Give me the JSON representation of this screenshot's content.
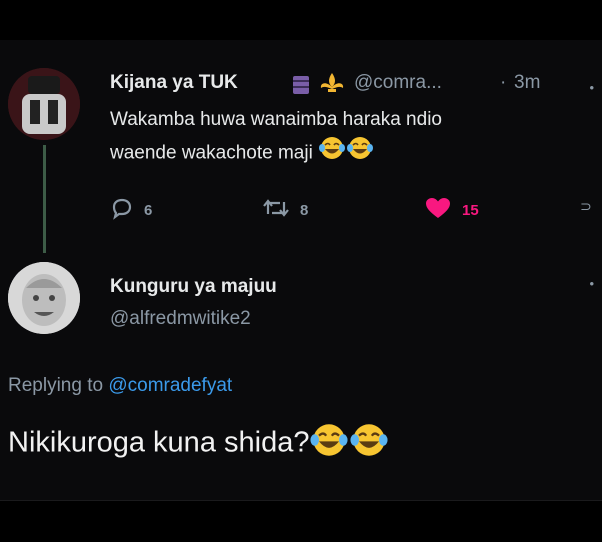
{
  "tweet": {
    "author_name": "Kijana ya TUK",
    "badge_icons": [
      "book-emoji-icon",
      "fleur-de-lis-icon"
    ],
    "handle": "@comra...",
    "separator": "·",
    "time": "3m",
    "text_line1": "Wakamba huwa wanaimba haraka ndio",
    "text_line2": "waende wakachote maji",
    "emoji": "joy-emoji-icon",
    "reply_count": "6",
    "retweet_count": "8",
    "like_count": "15",
    "like_color": "#f91880"
  },
  "reply": {
    "author_name": "Kunguru ya majuu",
    "handle": "@alfredmwitike2",
    "replying_prefix": "Replying to",
    "replying_to": "@comradefyat",
    "text": "Nikikuroga kuna shida?",
    "emoji": "joy-emoji-icon"
  },
  "colors": {
    "background": "#0a0a0c",
    "text": "#e7e9ea",
    "muted": "#8b98a5",
    "link": "#3b9aea",
    "thread_line": "#3d5c47"
  }
}
